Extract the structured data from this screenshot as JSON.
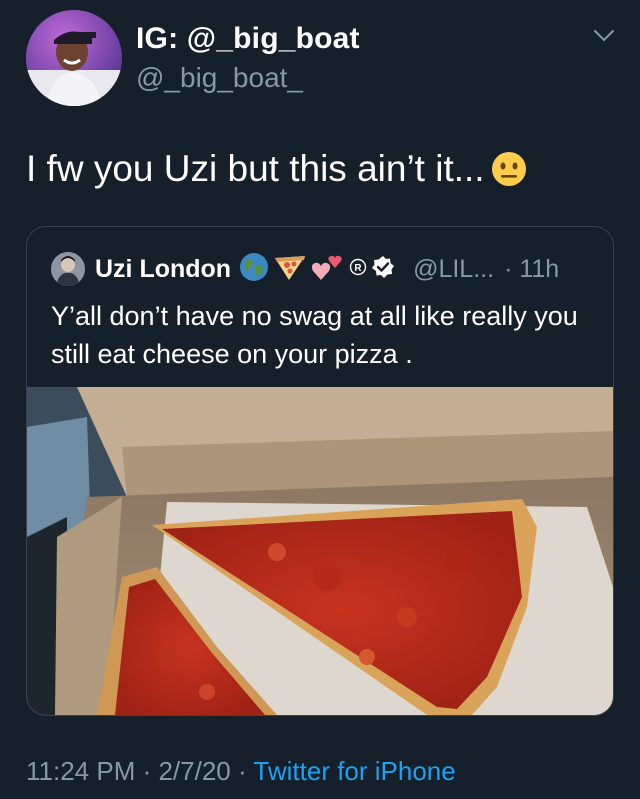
{
  "author": {
    "display_name": "IG: @_big_boat",
    "handle": "@_big_boat_"
  },
  "tweet": {
    "text": "I fw you Uzi but this ain’t it...",
    "emoji": "neutral-face"
  },
  "quoted_tweet": {
    "display_name": "Uzi London",
    "handle": "@LIL...",
    "time": "· 11h",
    "text": "Y’all don’t have no swag at all like really you still eat cheese on your pizza .",
    "name_emojis": [
      "globe-emoji",
      "pizza-emoji",
      "hearts-emoji",
      "registered-emoji",
      "verified-badge"
    ],
    "image": "pizza-slices-in-box-photo"
  },
  "meta": {
    "time": "11:24 PM",
    "date": "2/7/20",
    "separator": " · ",
    "source": "Twitter for iPhone"
  },
  "colors": {
    "background": "#15202b",
    "secondary_text": "#8899a6",
    "link": "#1da1f2",
    "border": "#38444d"
  }
}
